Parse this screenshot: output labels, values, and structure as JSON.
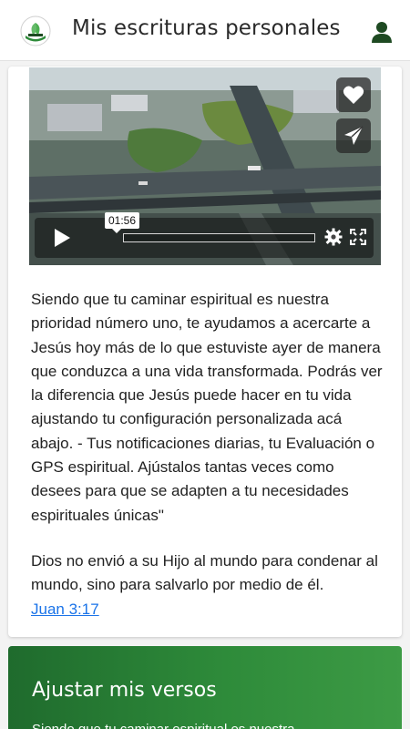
{
  "header": {
    "title": "Mis escrituras personales",
    "logo_icon": "leaf-logo-icon",
    "profile_icon": "user-icon"
  },
  "video": {
    "current_time": "01:56",
    "progress_fraction": 0.0,
    "buttons": [
      "heart-icon",
      "send-icon",
      "play-icon",
      "settings-gear-icon",
      "fullscreen-icon"
    ]
  },
  "content": {
    "paragraph": "Siendo que tu caminar espiritual es nuestra prioridad número uno, te ayudamos a acercarte a Jesús hoy más de lo que estuviste ayer de manera que conduzca a una vida transformada. Podrás ver la diferencia que Jesús puede hacer en tu vida ajustando tu configuración personalizada acá abajo. - Tus notificaciones diarias, tu Evaluación o GPS espiritual. Ajústalos tantas veces como desees para que se adapten a tu necesidades espirituales únicas\"",
    "verse": "Dios no envió a su Hijo al mundo para condenar al mundo, sino para salvarlo por medio de él.",
    "verse_ref": " Juan 3:17 "
  },
  "green_card": {
    "title": "Ajustar mis versos",
    "subtitle": "Siendo que tu caminar espiritual es nuestra"
  },
  "colors": {
    "brand_green": "#2e8b3a",
    "link_blue": "#1a73e8",
    "icon_dark_green": "#1e4a22"
  }
}
